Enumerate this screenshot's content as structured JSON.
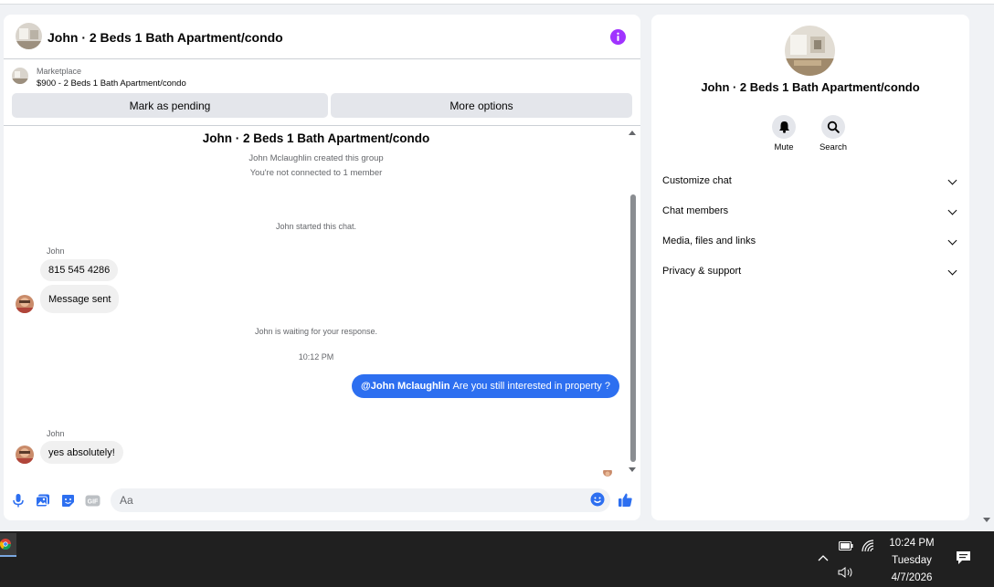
{
  "chat": {
    "header_title": "John · 2 Beds 1 Bath Apartment/condo",
    "marketplace_label": "Marketplace",
    "listing_price_title": "$900 - 2 Beds 1 Bath Apartment/condo",
    "mark_pending_label": "Mark as pending",
    "more_options_label": "More options",
    "group_title": "John · 2 Beds 1 Bath Apartment/condo",
    "created_text": "John Mclaughlin created this group",
    "not_connected_text": "You're not connected to 1 member",
    "started_text": "John started this chat.",
    "messages": [
      {
        "sender": "John",
        "text": "815 545 4286"
      },
      {
        "text": "Message sent"
      }
    ],
    "waiting_text": "John is waiting for your response.",
    "timestamp": "10:12 PM",
    "outgoing": {
      "mention": "@John Mclaughlin",
      "text": "Are you still interested in property ?"
    },
    "reply": {
      "sender": "John",
      "text": "yes absolutely!"
    },
    "composer_placeholder": "Aa",
    "gif_label": "GIF"
  },
  "side": {
    "name": "John · 2 Beds 1 Bath Apartment/condo",
    "mute_label": "Mute",
    "search_label": "Search",
    "sections": [
      "Customize chat",
      "Chat members",
      "Media, files and links",
      "Privacy & support"
    ]
  },
  "taskbar": {
    "time": "10:24 PM",
    "day": "Tuesday",
    "date": "4/7/2026"
  },
  "colors": {
    "accent_blue": "#2d6ff0",
    "info_purple": "#a033ff"
  }
}
